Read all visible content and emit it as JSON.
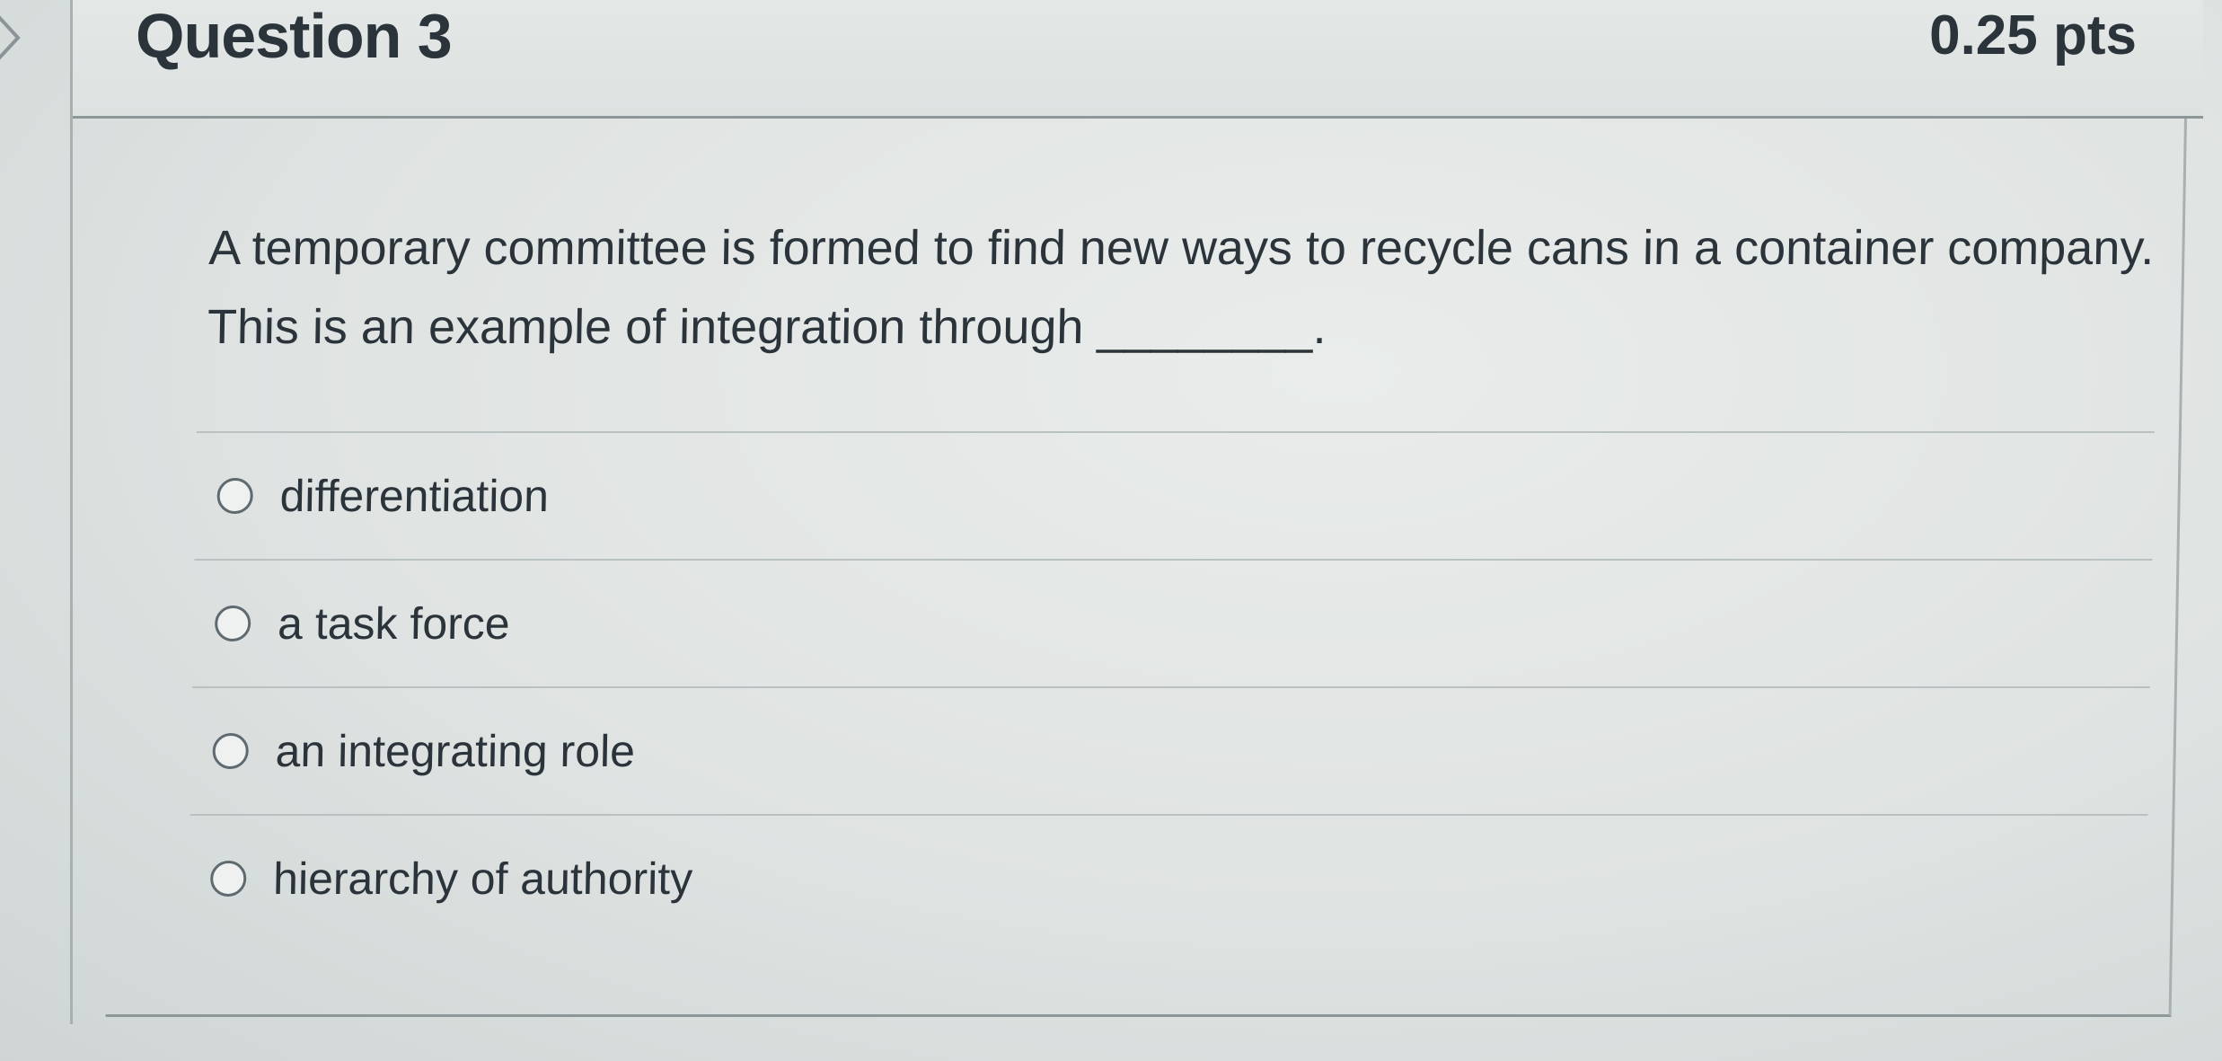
{
  "question": {
    "title": "Question 3",
    "points": "0.25 pts",
    "text": "A temporary committee is formed to find new ways to recycle cans in a container company. This is an example of integration through ________.",
    "answers": [
      {
        "label": "differentiation",
        "selected": false
      },
      {
        "label": "a task force",
        "selected": false
      },
      {
        "label": "an integrating role",
        "selected": false
      },
      {
        "label": "hierarchy of authority",
        "selected": false
      }
    ]
  },
  "icons": {
    "collapse_toggle": "chevron-right-icon"
  }
}
